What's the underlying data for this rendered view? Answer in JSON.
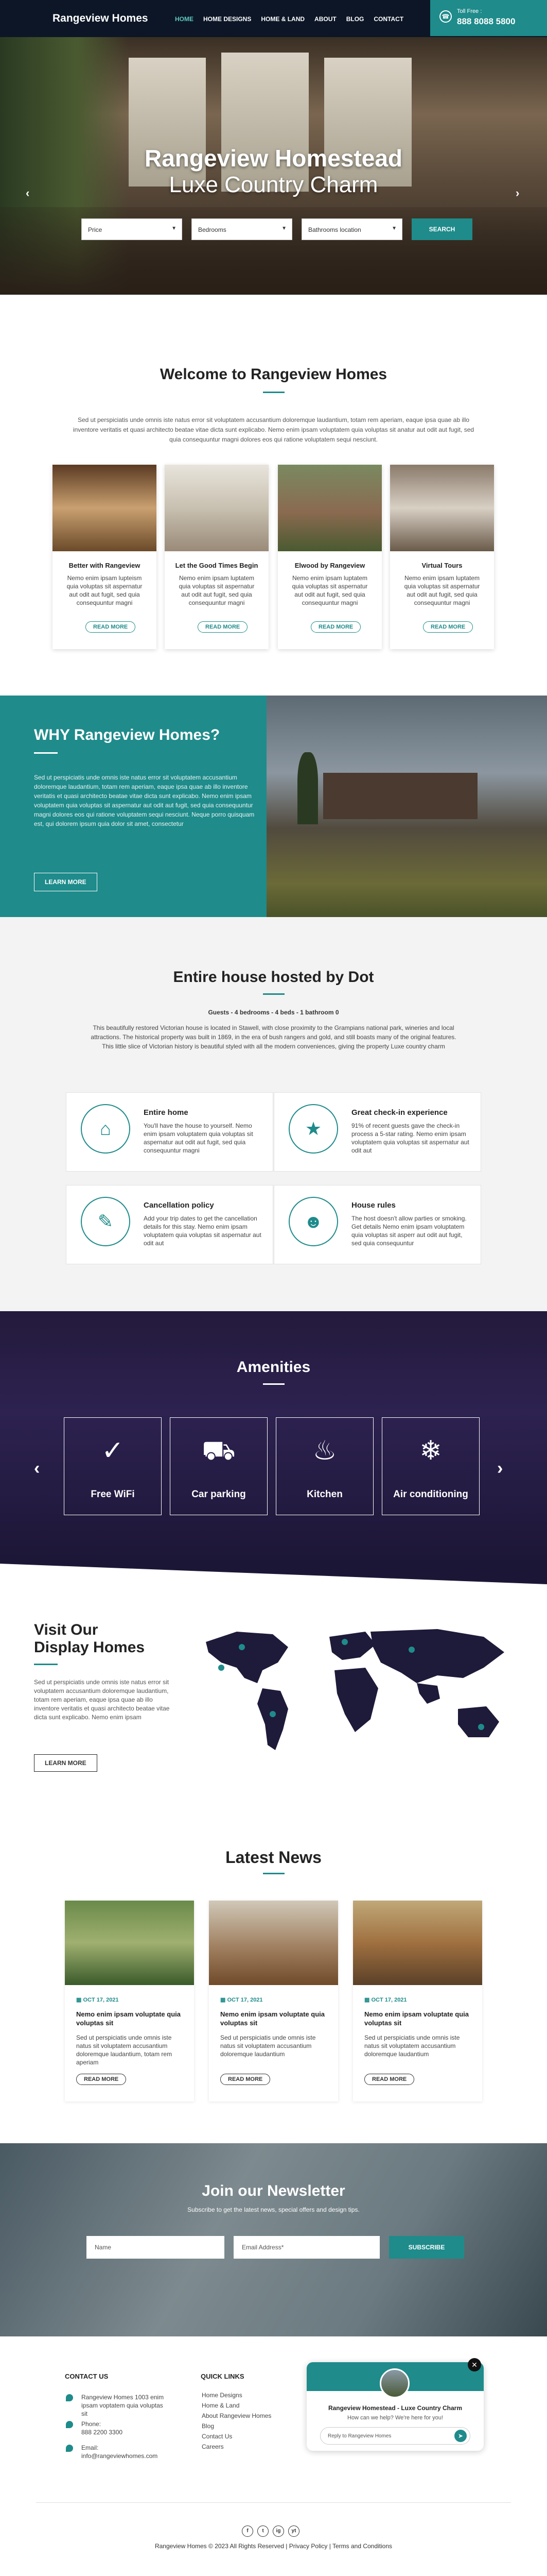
{
  "header": {
    "logo": "Rangeview Homes",
    "nav": [
      "HOME",
      "HOME DESIGNS",
      "HOME & LAND",
      "ABOUT",
      "BLOG",
      "CONTACT"
    ],
    "toll_label": "Toll Free :",
    "toll_number": "888 8088 5800"
  },
  "hero": {
    "title_line1": "Rangeview Homestead",
    "title_line2": "Luxe Country Charm",
    "search": {
      "price": "Price",
      "bedrooms": "Bedrooms",
      "bathrooms": "Bathrooms location",
      "button": "SEARCH"
    }
  },
  "welcome": {
    "title": "Welcome to Rangeview Homes",
    "text": "Sed ut perspiciatis unde omnis iste natus error sit voluptatem accusantium doloremque laudantium, totam rem aperiam, eaque ipsa quae ab illo inventore veritatis et quasi architecto beatae vitae dicta sunt explicabo. Nemo enim ipsam voluptatem quia voluptas sit anatur aut odit aut fugit, sed quia consequuntur magni dolores eos qui ratione voluptatem sequi nesciunt.",
    "cards": [
      {
        "title": "Better with Rangeview",
        "desc": "Nemo enim ipsam lupteism quia voluptas sit aspernatur aut odit aut fugit, sed quia consequuntur magni",
        "button": "READ MORE"
      },
      {
        "title": "Let the Good Times Begin",
        "desc": "Nemo enim ipsam luptatem quia voluptas sit aspernatur aut odit aut fugit, sed quia consequuntur magni",
        "button": "READ MORE"
      },
      {
        "title": "Elwood by Rangeview",
        "desc": "Nemo enim ipsam luptatem quia voluptas sit aspernatur aut odit aut fugit, sed quia consequuntur magni",
        "button": "READ MORE"
      },
      {
        "title": "Virtual Tours",
        "desc": "Nemo enim ipsam luptatem quia voluptas sit aspernatur aut odit aut fugit, sed quia consequuntur magni",
        "button": "READ MORE"
      }
    ]
  },
  "why": {
    "title": "WHY Rangeview Homes?",
    "text": "Sed ut perspiciatis unde omnis iste natus error sit voluptatem accusantium doloremque laudantium, totam rem aperiam, eaque ipsa quae ab illo inventore veritatis et quasi architecto beatae vitae dicta sunt explicabo. Nemo enim ipsam voluptatem quia voluptas sit aspernatur aut odit aut fugit, sed quia consequuntur magni dolores eos qui ratione voluptatem sequi nesciunt. Neque porro quisquam est, qui dolorem ipsum quia dolor sit amet, consectetur",
    "button": "LEARN MORE"
  },
  "house": {
    "title": "Entire house hosted by Dot",
    "sub": "Guests - 4 bedrooms - 4 beds - 1 bathroom 0",
    "text": "This beautifully restored Victorian house is located in Stawell, with close proximity to the Grampians national park, wineries and local attractions. The historical property was built in 1869, in the era of bush rangers and gold, and still boasts many of the original features. This little slice of Victorian history is beautiful styled with all the modern conveniences, giving the property Luxe country charm",
    "features": [
      {
        "title": "Entire home",
        "desc": "You'll have the house to yourself. Nemo enim ipsam voluptatem quia voluptas sit aspernatur aut odit aut fugit, sed quia consequuntur magni",
        "icon": "house-icon"
      },
      {
        "title": "Great check-in experience",
        "desc": "91% of recent guests gave the check-in process a 5-star rating. Nemo enim ipsam voluptatem quia voluptas sit aspernatur aut odit aut",
        "icon": "rating-icon"
      },
      {
        "title": "Cancellation policy",
        "desc": "Add your trip dates to get the cancellation details for this stay. Nemo enim ipsam voluptatem quia voluptas sit aspernatur aut odit aut",
        "icon": "policy-icon"
      },
      {
        "title": "House rules",
        "desc": "The host doesn't allow parties or smoking. Get details Nemo enim ipsam voluptatem quia voluptas sit asperr aut odit aut fugit, sed quia consequuntur",
        "icon": "rules-icon"
      }
    ]
  },
  "amenities": {
    "title": "Amenities",
    "items": [
      {
        "label": "Free WiFi",
        "icon": "wifi-icon"
      },
      {
        "label": "Car parking",
        "icon": "car-parking-icon"
      },
      {
        "label": "Kitchen",
        "icon": "kitchen-icon"
      },
      {
        "label": "Air conditioning",
        "icon": "air-conditioning-icon"
      }
    ]
  },
  "display": {
    "title_line1": "Visit Our",
    "title_line2": "Display Homes",
    "text": "Sed ut perspiciatis unde omnis iste natus error sit voluptatem accusantium doloremque laudantium, totam rem aperiam, eaque ipsa quae ab illo inventore veritatis et quasi architecto beatae vitae dicta sunt explicabo. Nemo enim ipsam",
    "button": "LEARN MORE"
  },
  "news": {
    "title": "Latest News",
    "items": [
      {
        "date": "OCT 17, 2021",
        "title": "Nemo enim ipsam voluptate quia voluptas sit",
        "text": "Sed ut perspiciatis unde omnis iste natus sit voluptatem accusantium doloremque laudantium, totam rem aperiam",
        "button": "READ MORE"
      },
      {
        "date": "OCT 17, 2021",
        "title": "Nemo enim ipsam voluptate quia voluptas sit",
        "text": "Sed ut perspiciatis unde omnis iste natus sit voluptatem accusantium doloremque laudantium",
        "button": "READ MORE"
      },
      {
        "date": "OCT 17, 2021",
        "title": "Nemo enim ipsam voluptate quia voluptas sit",
        "text": "Sed ut perspiciatis unde omnis iste natus sit voluptatem accusantium doloremque laudantium",
        "button": "READ MORE"
      }
    ]
  },
  "newsletter": {
    "title": "Join our Newsletter",
    "sub": "Subscribe to get the latest news, special offers and design tips.",
    "name_placeholder": "Name",
    "email_placeholder": "Email Address*",
    "button": "SUBSCRIBE"
  },
  "footer": {
    "contact_title": "CONTACT US",
    "address": "Rangeview Homes 1003 enim ipsam voptatem quia voluptas sit",
    "phone_label": "Phone:",
    "phone": "888 2200 3300",
    "email_label": "Email:",
    "email": "info@rangeviewhomes.com",
    "links_title": "QUICK LINKS",
    "links": [
      "Home Designs",
      "Home & Land",
      "About Rangeview Homes",
      "Blog",
      "Contact Us",
      "Careers"
    ],
    "chat_name": "Rangeview Homestead - Luxe Country Charm",
    "chat_help": "How can we help? We're here for you!",
    "chat_placeholder": "Reply to Rangeview Homes",
    "social": [
      "f",
      "t",
      "ig",
      "yt"
    ],
    "copyright": "Rangeview Homes © 2023 All Rights Reserved | Privacy Policy | Terms and Conditions"
  },
  "colors": {
    "accent": "#1f8b8b",
    "header_bg": "#0c1626",
    "amenities_bg": "#2d2250",
    "map_fill": "#1e1a3a"
  }
}
